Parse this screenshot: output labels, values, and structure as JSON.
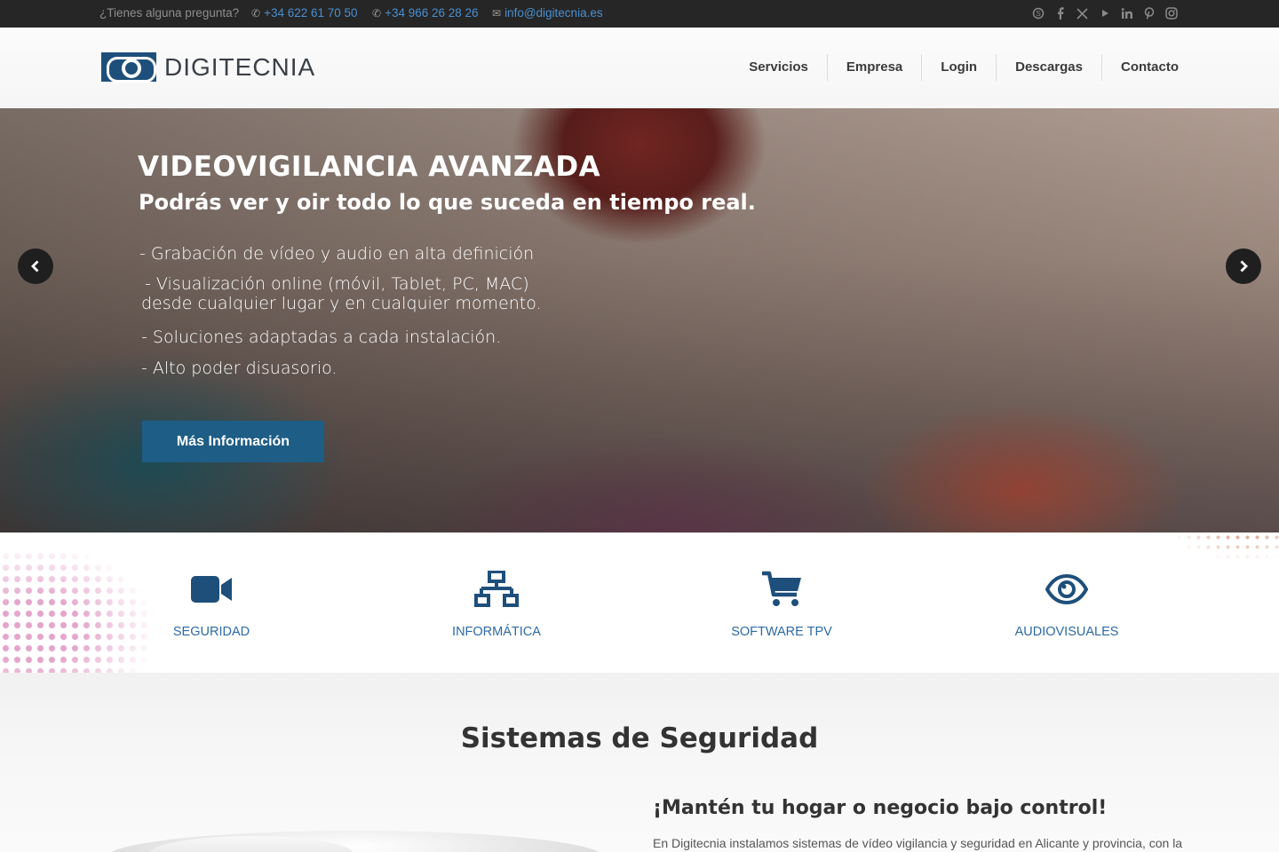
{
  "topbar": {
    "question": "¿Tienes alguna pregunta?",
    "phone1": "+34 622 61 70 50",
    "phone2": "+34 966 26 28 26",
    "email": "info@digitecnia.es",
    "social_icons": [
      "skype-icon",
      "facebook-icon",
      "x-icon",
      "youtube-icon",
      "linkedin-icon",
      "pinterest-icon",
      "instagram-icon"
    ]
  },
  "header": {
    "logo_text": "DIGITECNIA",
    "nav": [
      "Servicios",
      "Empresa",
      "Login",
      "Descargas",
      "Contacto"
    ]
  },
  "hero": {
    "title": "VIDEOVIGILANCIA AVANZADA",
    "subtitle": "Podrás ver y oir todo lo que suceda en tiempo real.",
    "features": [
      "- Grabación de vídeo y audio en alta definición",
      " - Visualización online (móvil, Tablet, PC, MAC)",
      "desde cualquier lugar y en cualquier momento.",
      "- Soluciones adaptadas a cada instalación.",
      "- Alto poder disuasorio."
    ],
    "button_label": "Más Información"
  },
  "services": [
    {
      "icon": "video-camera-icon",
      "label": "SEGURIDAD"
    },
    {
      "icon": "network-icon",
      "label": "INFORMÁTICA"
    },
    {
      "icon": "shopping-cart-icon",
      "label": "SOFTWARE TPV"
    },
    {
      "icon": "eye-icon",
      "label": "AUDIOVISUALES"
    }
  ],
  "section": {
    "title": "Sistemas de Seguridad",
    "subtitle": "¡Mantén tu hogar o negocio bajo control!",
    "text": "En Digitecnia instalamos sistemas de vídeo vigilancia y seguridad en Alicante y provincia, con la"
  },
  "colors": {
    "brand_blue": "#1e4f7b",
    "link_blue": "#2d6aa5",
    "button_blue": "#1e5d85",
    "topbar_bg": "#262626"
  }
}
